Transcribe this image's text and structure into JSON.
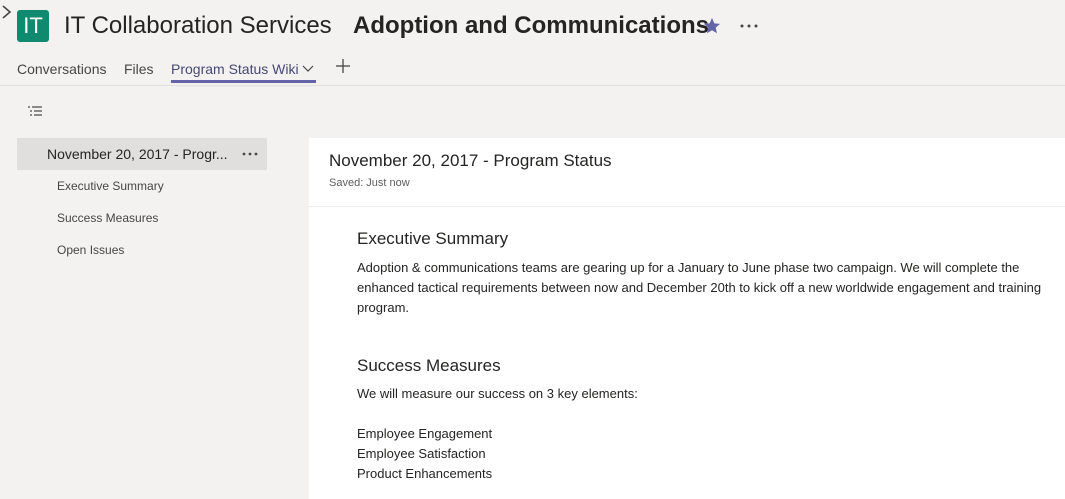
{
  "header": {
    "team_avatar_text": "IT",
    "team_name": "IT Collaboration Services",
    "channel_name": "Adoption and Communications",
    "accent_color": "#6264a7",
    "avatar_color": "#0f8a6e"
  },
  "tabs": {
    "conversations": "Conversations",
    "files": "Files",
    "wiki": "Program Status Wiki"
  },
  "sidebar": {
    "page": "November 20, 2017 - Progr...",
    "sections": [
      "Executive Summary",
      "Success Measures",
      "Open Issues"
    ]
  },
  "document": {
    "title": "November 20, 2017 - Program Status",
    "saved": "Saved: Just now",
    "executive_summary": {
      "heading": "Executive Summary",
      "body": "Adoption & communications teams are gearing up for a January to June phase two campaign.  We will complete the enhanced tactical requirements between now and December 20th to kick off a new worldwide engagement and training program."
    },
    "success_measures": {
      "heading": "Success Measures",
      "intro": "We will measure our success on 3 key elements:",
      "items": [
        "Employee Engagement",
        "Employee Satisfaction",
        "Product Enhancements"
      ]
    }
  }
}
